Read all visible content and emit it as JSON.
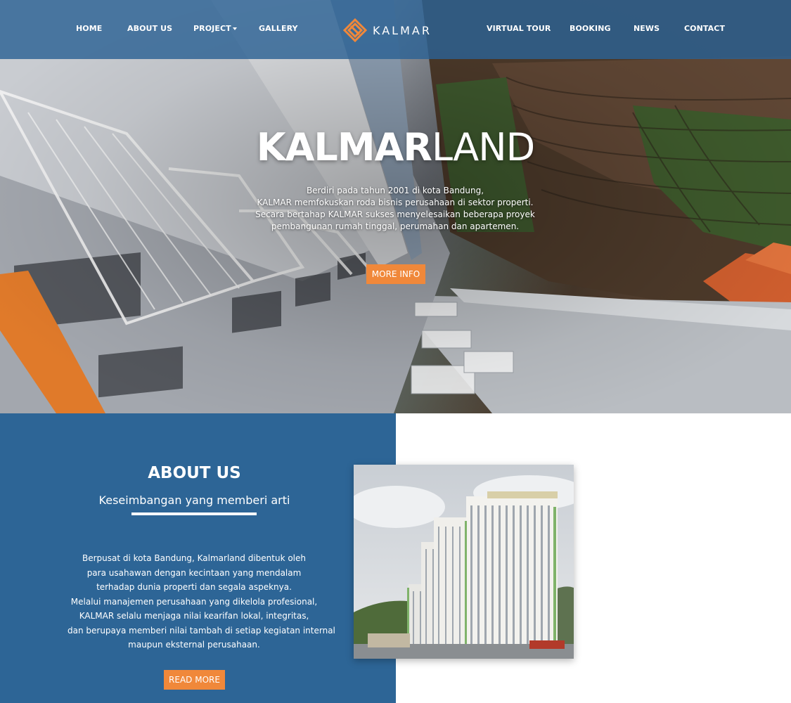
{
  "nav": {
    "items_left": [
      {
        "label": "HOME"
      },
      {
        "label": "ABOUT US"
      },
      {
        "label": "PROJECT"
      },
      {
        "label": "GALLERY"
      }
    ],
    "items_right": [
      {
        "label": "VIRTUAL TOUR"
      },
      {
        "label": "BOOKING"
      },
      {
        "label": "NEWS"
      },
      {
        "label": "CONTACT"
      }
    ],
    "brand": "KALMAR"
  },
  "hero": {
    "title_bold": "KALMAR",
    "title_light": "LAND",
    "description_lines": [
      "Berdiri pada tahun 2001 di kota Bandung,",
      "KALMAR memfokuskan roda bisnis perusahaan di sektor properti.",
      "Secara bertahap KALMAR sukses menyelesaikan beberapa proyek",
      "pembangunan rumah tinggal, perumahan dan apartemen."
    ],
    "cta_label": "MORE INFO"
  },
  "about": {
    "title": "ABOUT US",
    "subtitle": "Keseimbangan yang memberi arti",
    "body_lines": [
      "Berpusat di kota Bandung, Kalmarland dibentuk oleh",
      "para usahawan dengan kecintaan yang mendalam",
      "terhadap dunia properti dan segala aspeknya.",
      "Melalui manajemen perusahaan yang dikelola profesional,",
      "KALMAR selalu menjaga nilai kearifan lokal, integritas,",
      "dan berupaya memberi nilai tambah di setiap kegiatan internal",
      "maupun eksternal perusahaan."
    ],
    "cta_label": "READ MORE"
  },
  "colors": {
    "navbar": "#2c6294",
    "about_panel": "#2d6596",
    "accent_orange": "#f0883a",
    "text_light": "#ffffff"
  },
  "icons": {
    "brand_logo": "kalmar-diamond-logo-icon",
    "dropdown": "caret-down-icon"
  }
}
